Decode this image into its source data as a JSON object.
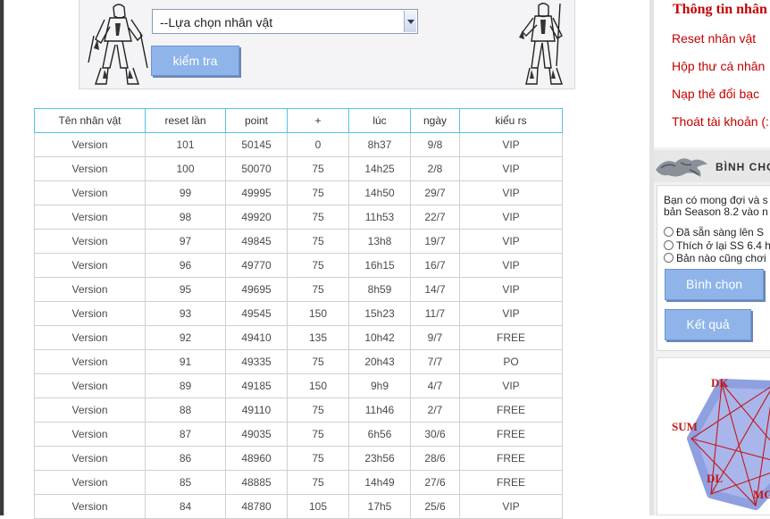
{
  "search": {
    "select_value": "--Lựa chọn nhân vật",
    "check_button": "kiểm tra"
  },
  "table": {
    "headers": [
      "Tên nhân vật",
      "reset lần",
      "point",
      "+",
      "lúc",
      "ngày",
      "kiểu rs"
    ],
    "rows": [
      [
        "Version",
        "101",
        "50145",
        "0",
        "8h37",
        "9/8",
        "VIP"
      ],
      [
        "Version",
        "100",
        "50070",
        "75",
        "14h25",
        "2/8",
        "VIP"
      ],
      [
        "Version",
        "99",
        "49995",
        "75",
        "14h50",
        "29/7",
        "VIP"
      ],
      [
        "Version",
        "98",
        "49920",
        "75",
        "11h53",
        "22/7",
        "VIP"
      ],
      [
        "Version",
        "97",
        "49845",
        "75",
        "13h8",
        "19/7",
        "VIP"
      ],
      [
        "Version",
        "96",
        "49770",
        "75",
        "16h15",
        "16/7",
        "VIP"
      ],
      [
        "Version",
        "95",
        "49695",
        "75",
        "8h59",
        "14/7",
        "VIP"
      ],
      [
        "Version",
        "93",
        "49545",
        "150",
        "15h23",
        "11/7",
        "VIP"
      ],
      [
        "Version",
        "92",
        "49410",
        "135",
        "10h42",
        "9/7",
        "FREE"
      ],
      [
        "Version",
        "91",
        "49335",
        "75",
        "20h43",
        "7/7",
        "PO"
      ],
      [
        "Version",
        "89",
        "49185",
        "150",
        "9h9",
        "4/7",
        "VIP"
      ],
      [
        "Version",
        "88",
        "49110",
        "75",
        "11h46",
        "2/7",
        "FREE"
      ],
      [
        "Version",
        "87",
        "49035",
        "75",
        "6h56",
        "30/6",
        "FREE"
      ],
      [
        "Version",
        "86",
        "48960",
        "75",
        "23h56",
        "28/6",
        "FREE"
      ],
      [
        "Version",
        "85",
        "48885",
        "75",
        "14h49",
        "27/6",
        "FREE"
      ],
      [
        "Version",
        "84",
        "48780",
        "105",
        "17h5",
        "25/6",
        "VIP"
      ]
    ]
  },
  "sidebar": {
    "title": "Thông tin nhân",
    "links": [
      "Reset nhân vật",
      "Hộp thư cá nhân",
      "Nạp thẻ đổi bạc",
      "Thoát tài khoản (:"
    ],
    "poll": {
      "heading": "BÌNH CHỌ",
      "question_line1": "Bạn có mong đợi và s",
      "question_line2": "bản Season 8.2 vào n",
      "options": [
        "Đã sẵn sàng lên S",
        "Thích ở lại SS 6.4 h",
        "Bản nào cũng chơi"
      ],
      "vote_button": "Bình chọn",
      "result_button": "Kết quả"
    },
    "class_chart": {
      "labels": [
        "DK",
        "SUM",
        "DL",
        "MG"
      ]
    }
  },
  "colors": {
    "accent_red": "#c40000",
    "button_blue": "#8fb4ea",
    "table_header_border": "#55c2e6"
  }
}
